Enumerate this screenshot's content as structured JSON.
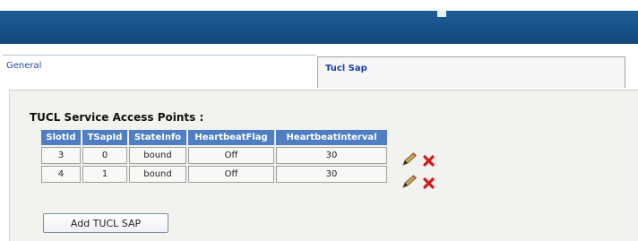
{
  "tabs": {
    "general_label": "General",
    "tucl_label": "Tucl Sap"
  },
  "section": {
    "title": "TUCL Service Access Points :"
  },
  "table": {
    "headers": [
      "SlotId",
      "TSapId",
      "StateInfo",
      "HeartbeatFlag",
      "HeartbeatInterval"
    ],
    "rows": [
      [
        "3",
        "0",
        "bound",
        "Off",
        "30"
      ],
      [
        "4",
        "1",
        "bound",
        "Off",
        "30"
      ]
    ]
  },
  "actions": {
    "edit_icon": "pencil-icon",
    "delete_icon": "red-x-icon"
  },
  "buttons": {
    "add_label": "Add TUCL SAP"
  },
  "colors": {
    "header_bar": "#1a5590",
    "table_header": "#4f7fc2",
    "tab_active_text": "#1b3fb0",
    "delete_red": "#d21a1a",
    "panel_bg": "#f2f2ee"
  }
}
